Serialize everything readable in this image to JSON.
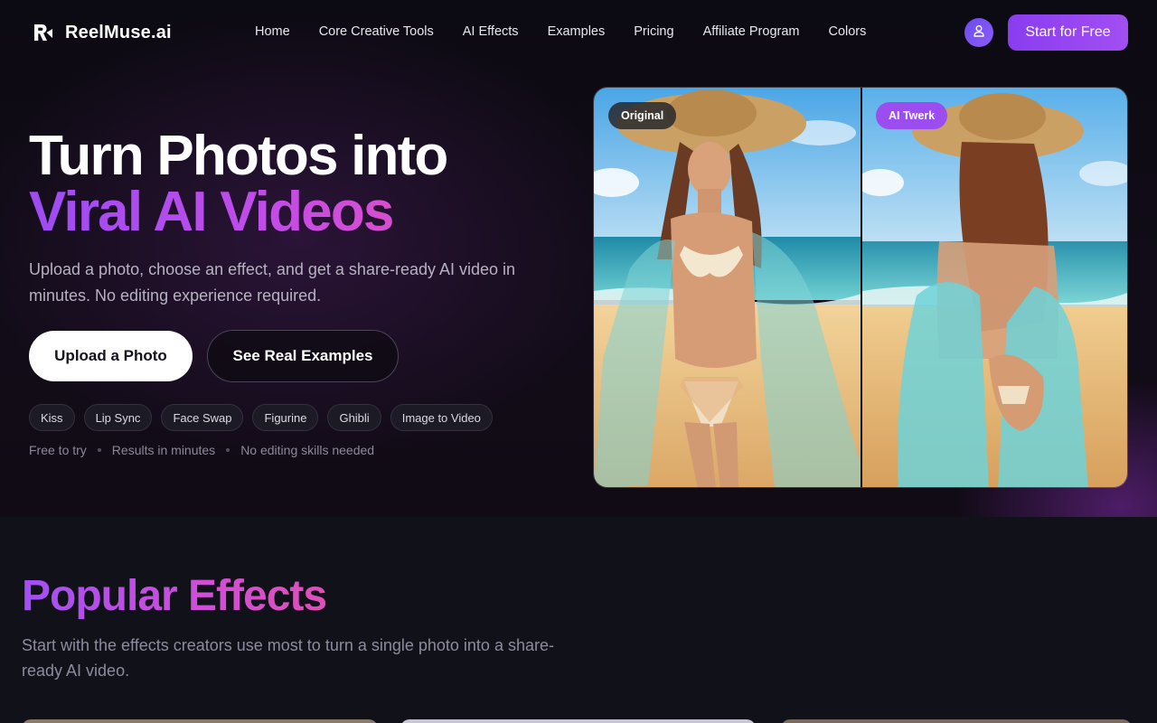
{
  "brand": {
    "name": "ReelMuse.ai"
  },
  "nav": {
    "items": [
      {
        "label": "Home"
      },
      {
        "label": "Core Creative Tools"
      },
      {
        "label": "AI Effects"
      },
      {
        "label": "Examples"
      },
      {
        "label": "Pricing"
      },
      {
        "label": "Affiliate Program"
      },
      {
        "label": "Colors"
      }
    ],
    "account_icon": "user-icon",
    "cta_label": "Start for Free"
  },
  "hero": {
    "title_line1": "Turn Photos into",
    "title_line2": "Viral AI Videos",
    "subtitle": "Upload a photo, choose an effect, and get a share-ready AI video in minutes. No editing experience required.",
    "primary_button": "Upload a Photo",
    "secondary_button": "See Real Examples",
    "tags": [
      "Kiss",
      "Lip Sync",
      "Face Swap",
      "Figurine",
      "Ghibli",
      "Image to Video"
    ],
    "trust_points": [
      "Free to try",
      "Results in minutes",
      "No editing skills needed"
    ]
  },
  "comparison": {
    "left_badge": "Original",
    "right_badge": "AI Twerk"
  },
  "effects_section": {
    "title": "Popular Effects",
    "subtitle": "Start with the effects creators use most to turn a single photo into a share-ready AI video."
  },
  "colors": {
    "accent": "#9b4df0",
    "gradient_pink": "#e14fc4",
    "background": "#0b0a10",
    "section_bg": "#11111a"
  }
}
